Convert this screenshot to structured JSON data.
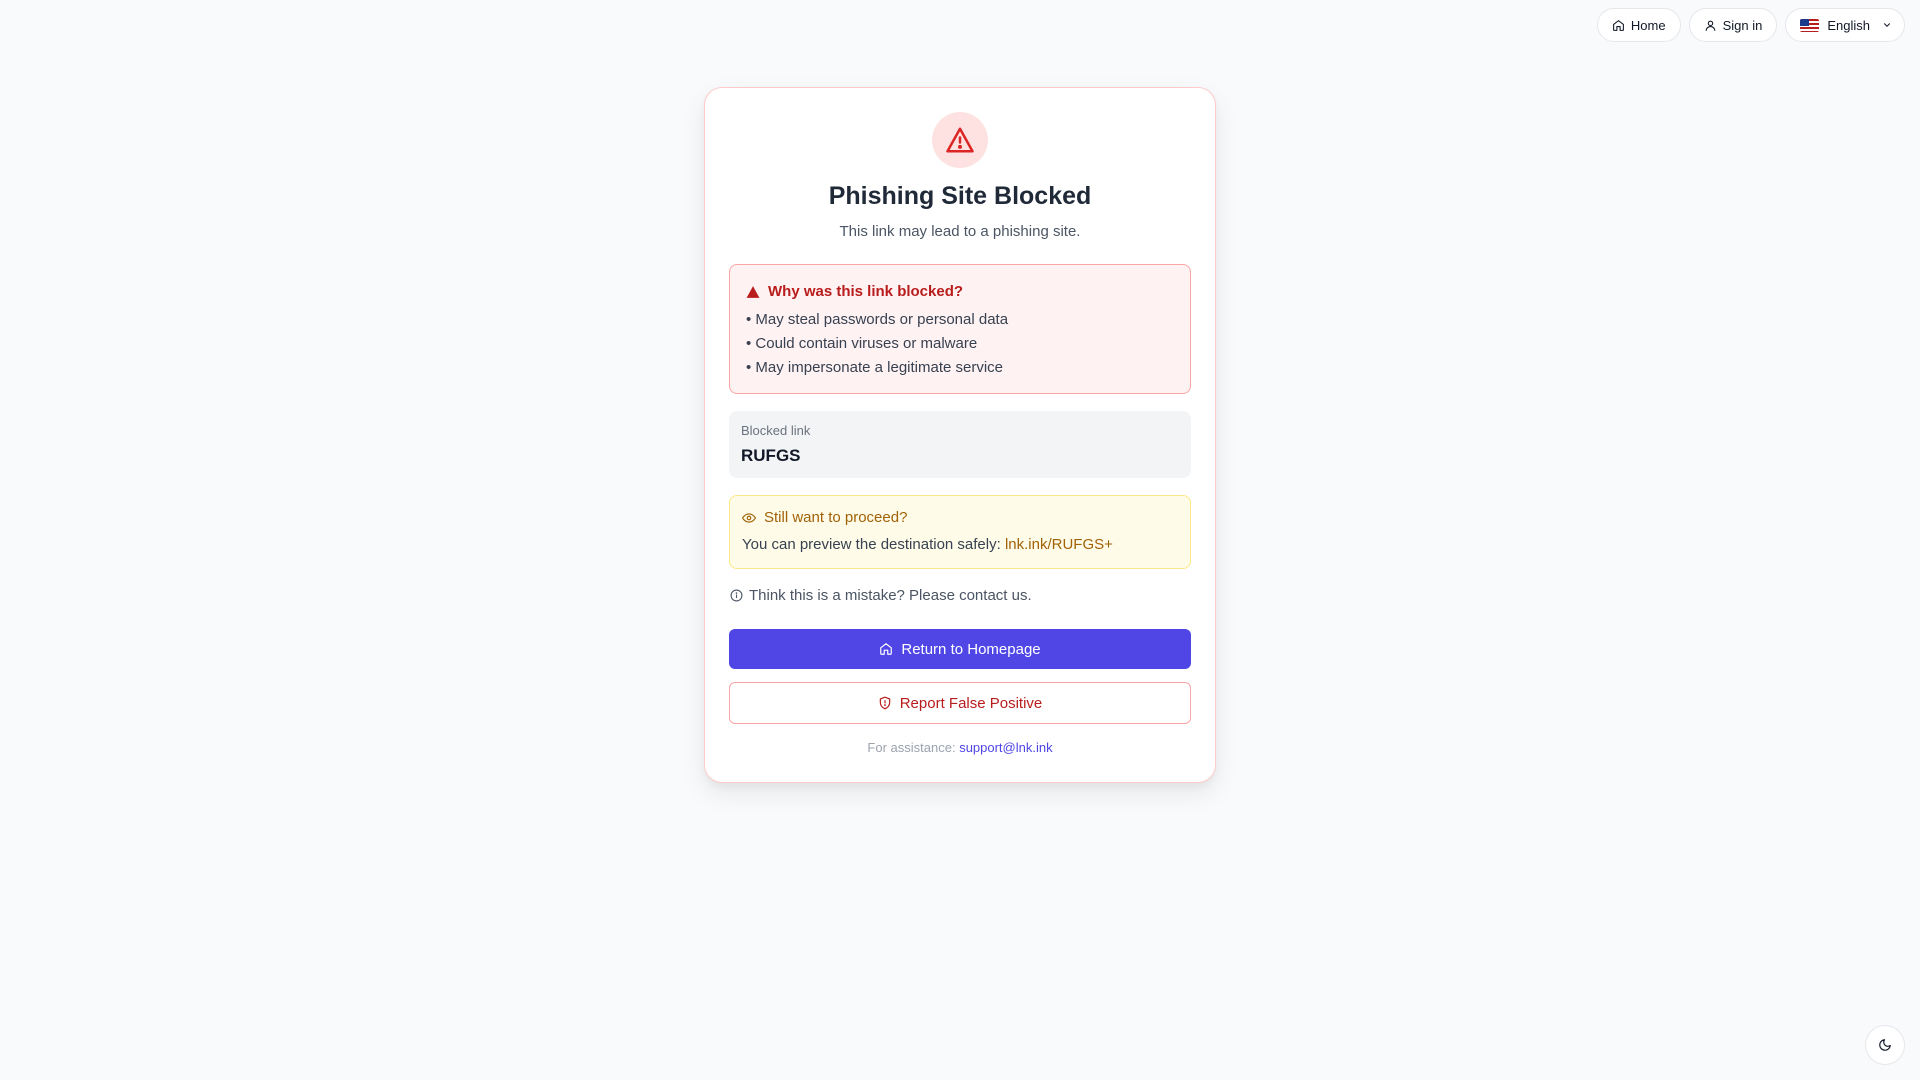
{
  "nav": {
    "home_label": "Home",
    "signin_label": "Sign in",
    "language_label": "English"
  },
  "card": {
    "title": "Phishing Site Blocked",
    "subtitle": "This link may lead to a phishing site.",
    "reasons": {
      "heading": "Why was this link blocked?",
      "items": [
        "• May steal passwords or personal data",
        "• Could contain viruses or malware",
        "• May impersonate a legitimate service"
      ]
    },
    "blocked": {
      "label": "Blocked link",
      "value": "RUFGS"
    },
    "proceed": {
      "heading": "Still want to proceed?",
      "text": "You can preview the destination safely:",
      "link": "lnk.ink/RUFGS+"
    },
    "mistake": "Think this is a mistake? Please contact us.",
    "return_label": "Return to Homepage",
    "report_label": "Report False Positive",
    "assist": {
      "text": "For assistance:",
      "email": "support@lnk.ink"
    }
  },
  "colors": {
    "primary": "#4f46e5",
    "danger": "#b91c1c",
    "warning": "#a16207"
  }
}
